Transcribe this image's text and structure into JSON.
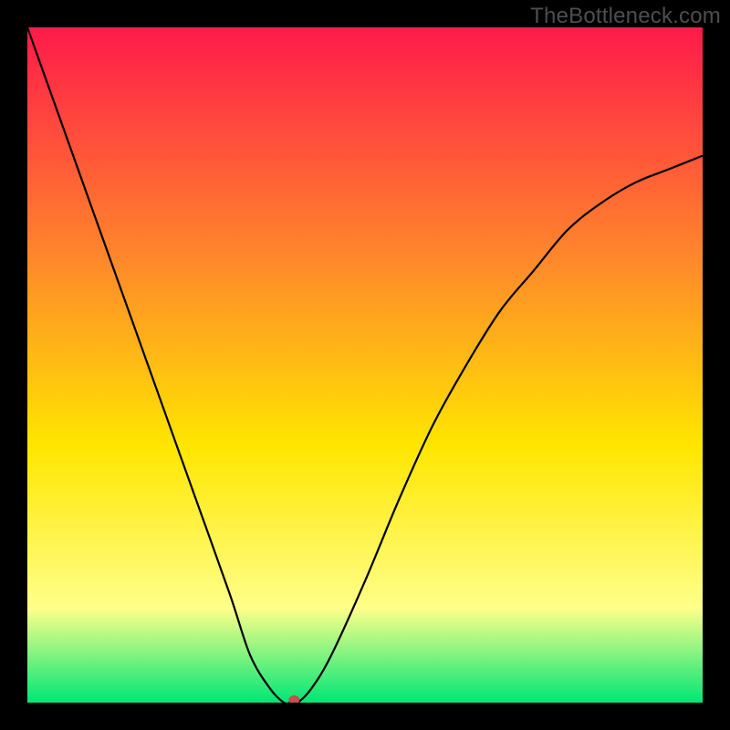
{
  "watermark": "TheBottleneck.com",
  "chart_data": {
    "type": "line",
    "title": "",
    "xlabel": "",
    "ylabel": "",
    "xlim": [
      0,
      1
    ],
    "ylim": [
      0,
      1
    ],
    "background_gradient": {
      "top": "#ff1a4a",
      "mid1": "#ff8a2a",
      "mid2": "#ffe600",
      "mid3": "#ffff8a",
      "bottom": "#00e676"
    },
    "series": [
      {
        "name": "bottleneck-curve",
        "x": [
          0.0,
          0.05,
          0.1,
          0.15,
          0.2,
          0.25,
          0.3,
          0.33,
          0.36,
          0.38,
          0.39,
          0.4,
          0.42,
          0.45,
          0.5,
          0.55,
          0.6,
          0.65,
          0.7,
          0.75,
          0.8,
          0.85,
          0.9,
          0.95,
          1.0
        ],
        "y": [
          1.0,
          0.86,
          0.72,
          0.58,
          0.44,
          0.3,
          0.16,
          0.07,
          0.02,
          0.0,
          0.0,
          0.0,
          0.02,
          0.07,
          0.18,
          0.3,
          0.41,
          0.5,
          0.58,
          0.64,
          0.7,
          0.74,
          0.77,
          0.79,
          0.81
        ]
      }
    ],
    "marker": {
      "x": 0.395,
      "y": 0.0,
      "color": "#c94d49",
      "rx": 6,
      "ry": 5
    }
  }
}
